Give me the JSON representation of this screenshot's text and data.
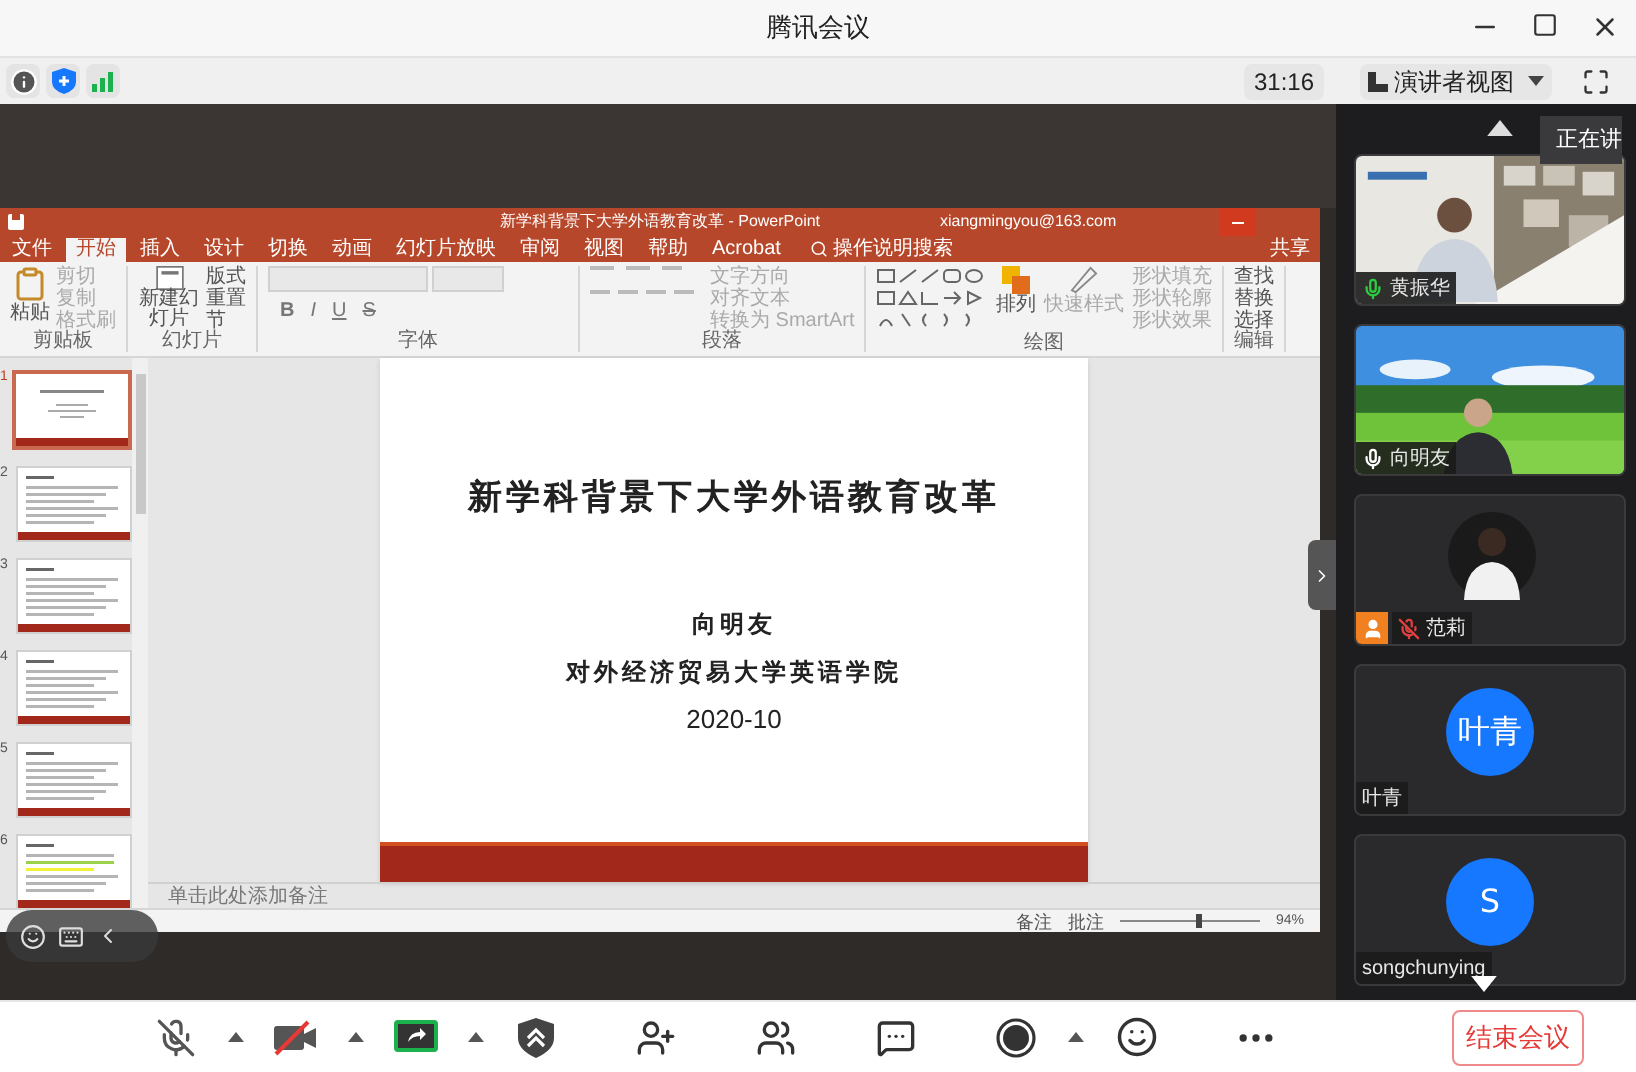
{
  "window": {
    "title": "腾讯会议"
  },
  "info_bar": {
    "timer": "31:16",
    "view_button": "演讲者视图"
  },
  "ppt": {
    "title": "新学科背景下大学外语教育改革 - PowerPoint",
    "account": "xiangmingyou@163.com",
    "share": "共享",
    "search": "操作说明搜索",
    "tabs": [
      {
        "label": "文件",
        "selected": false
      },
      {
        "label": "开始",
        "selected": true
      },
      {
        "label": "插入",
        "selected": false
      },
      {
        "label": "设计",
        "selected": false
      },
      {
        "label": "切换",
        "selected": false
      },
      {
        "label": "动画",
        "selected": false
      },
      {
        "label": "幻灯片放映",
        "selected": false
      },
      {
        "label": "审阅",
        "selected": false
      },
      {
        "label": "视图",
        "selected": false
      },
      {
        "label": "帮助",
        "selected": false
      },
      {
        "label": "Acrobat",
        "selected": false
      }
    ],
    "ribbon": [
      {
        "kind": "clipboard",
        "group": "剪贴板",
        "items": [
          "粘贴",
          "剪切",
          "复制",
          "格式刷"
        ]
      },
      {
        "kind": "slides",
        "group": "幻灯片",
        "items": [
          "新建幻灯片",
          "版式",
          "重置",
          "节"
        ]
      },
      {
        "kind": "font",
        "group": "字体",
        "items": [
          "B",
          "I",
          "U",
          "S"
        ]
      },
      {
        "kind": "paragraph",
        "group": "段落",
        "items": [
          "文字方向",
          "对齐文本",
          "转换为 SmartArt"
        ]
      },
      {
        "kind": "drawing",
        "group": "绘图",
        "items": [
          "排列",
          "快速样式",
          "形状填充",
          "形状轮廓",
          "形状效果"
        ]
      },
      {
        "kind": "editing",
        "group": "编辑",
        "items": [
          "查找",
          "替换",
          "选择"
        ]
      }
    ],
    "slides": [
      {
        "number": "1",
        "selected": true
      },
      {
        "number": "2",
        "selected": false
      },
      {
        "number": "3",
        "selected": false
      },
      {
        "number": "4",
        "selected": false
      },
      {
        "number": "5",
        "selected": false
      },
      {
        "number": "6",
        "selected": false
      }
    ],
    "slide": {
      "title": "新学科背景下大学外语教育改革",
      "author": "向明友",
      "affiliation": "对外经济贸易大学英语学院",
      "date": "2020-10"
    },
    "notes_placeholder": "单击此处添加备注",
    "status": {
      "notes": "备注",
      "comments": "批注",
      "zoom": "94%",
      "level": 0.55
    }
  },
  "speaking_tip": "正在讲",
  "participants": [
    {
      "name": "黄振华",
      "kind": "video",
      "mic": true,
      "speaking": true,
      "muted": false,
      "host": false
    },
    {
      "name": "向明友",
      "kind": "video",
      "mic": true,
      "speaking": false,
      "muted": false,
      "host": false
    },
    {
      "name": "范莉",
      "mic": true,
      "muted": true,
      "host": true
    },
    {
      "name": "叶青",
      "kind": "initial",
      "avatar_text": "叶青",
      "mic": false,
      "host": false
    },
    {
      "name": "songchunying",
      "kind": "initial",
      "avatar_text": "S",
      "mic": false,
      "host": false
    }
  ],
  "toolbar": [
    {
      "kind": "mic-muted",
      "menu": true
    },
    {
      "kind": "camera-off",
      "menu": true
    },
    {
      "kind": "share",
      "menu": true
    },
    {
      "kind": "security",
      "menu": false
    },
    {
      "kind": "invite",
      "menu": false
    },
    {
      "kind": "members",
      "menu": false
    },
    {
      "kind": "chat",
      "menu": false
    },
    {
      "kind": "record",
      "menu": true
    },
    {
      "kind": "reactions",
      "menu": false
    },
    {
      "kind": "more",
      "menu": false
    }
  ],
  "end_button": "结束会议"
}
